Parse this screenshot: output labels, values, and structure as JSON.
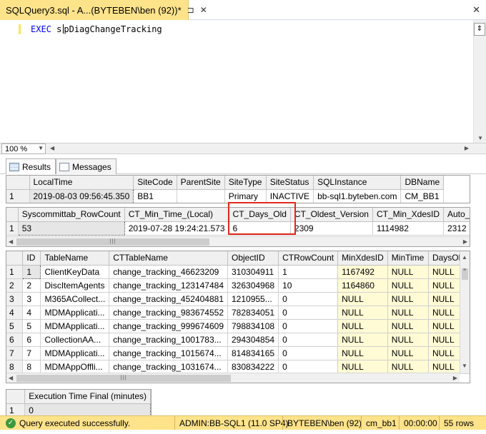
{
  "window": {
    "tab_title": "SQLQuery3.sql - A...(BYTEBEN\\ben (92))*",
    "pin_icon": "pin-icon",
    "close_icon": "close-icon"
  },
  "editor": {
    "keyword": "EXEC",
    "procedure": "spDiagChangeTracking"
  },
  "zoom": {
    "value": "100 %"
  },
  "results_tabs": [
    {
      "label": "Results",
      "icon": "grid-icon"
    },
    {
      "label": "Messages",
      "icon": "messages-icon"
    }
  ],
  "grid1": {
    "columns": [
      "LocalTime",
      "SiteCode",
      "ParentSite",
      "SiteType",
      "SiteStatus",
      "SQLInstance",
      "DBName"
    ],
    "rows": [
      [
        "1",
        "2019-08-03 09:56:45.350",
        "BB1",
        "",
        "Primary",
        "INACTIVE",
        "bb-sql1.byteben.com",
        "CM_BB1"
      ]
    ]
  },
  "grid2": {
    "columns": [
      "Syscommittab_RowCount",
      "CT_Min_Time_(Local)",
      "CT_Days_Old",
      "CT_Oldest_Version",
      "CT_Min_XdesID",
      "Auto_Cl"
    ],
    "rows": [
      [
        "1",
        "53",
        "2019-07-28 19:24:21.573",
        "6",
        "2309",
        "1114982",
        "2312"
      ]
    ]
  },
  "grid3": {
    "columns": [
      "ID",
      "TableName",
      "CTTableName",
      "ObjectID",
      "CTRowCount",
      "MinXdesID",
      "MinTime",
      "DaysOld"
    ],
    "rows": [
      [
        "1",
        "1",
        "ClientKeyData",
        "change_tracking_46623209",
        "310304911",
        "1",
        "1167492",
        "NULL",
        "NULL"
      ],
      [
        "2",
        "2",
        "DiscItemAgents",
        "change_tracking_123147484",
        "326304968",
        "10",
        "1164860",
        "NULL",
        "NULL"
      ],
      [
        "3",
        "3",
        "M365ACollect...",
        "change_tracking_452404881",
        "1210955...",
        "0",
        "NULL",
        "NULL",
        "NULL"
      ],
      [
        "4",
        "4",
        "MDMApplicati...",
        "change_tracking_983674552",
        "782834051",
        "0",
        "NULL",
        "NULL",
        "NULL"
      ],
      [
        "5",
        "5",
        "MDMApplicati...",
        "change_tracking_999674609",
        "798834108",
        "0",
        "NULL",
        "NULL",
        "NULL"
      ],
      [
        "6",
        "6",
        "CollectionAA...",
        "change_tracking_1001783...",
        "294304854",
        "0",
        "NULL",
        "NULL",
        "NULL"
      ],
      [
        "7",
        "7",
        "MDMApplicati...",
        "change_tracking_1015674...",
        "814834165",
        "0",
        "NULL",
        "NULL",
        "NULL"
      ],
      [
        "8",
        "8",
        "MDMAppOffli...",
        "change_tracking_1031674...",
        "830834222",
        "0",
        "NULL",
        "NULL",
        "NULL"
      ]
    ]
  },
  "grid4": {
    "columns": [
      "Execution Time Final (minutes)"
    ],
    "rows": [
      [
        "1",
        "0"
      ]
    ]
  },
  "status": {
    "message": "Query executed successfully.",
    "server": "ADMIN:BB-SQL1 (11.0 SP4)",
    "user": "BYTEBEN\\ben (92)",
    "database": "cm_bb1",
    "elapsed": "00:00:00",
    "rows": "55 rows"
  },
  "colors": {
    "status_bar": "#ffe38b",
    "null_cell": "#fffbd5",
    "highlight": "#e2281c",
    "keyword": "#0000ff"
  }
}
